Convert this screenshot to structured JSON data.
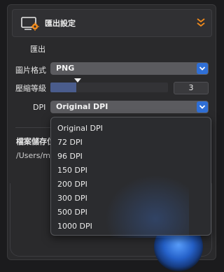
{
  "header": {
    "title": "匯出設定"
  },
  "section": {
    "label": "匯出"
  },
  "format": {
    "label": "圖片格式",
    "value": "PNG"
  },
  "compression": {
    "label": "壓縮等級",
    "value": "3",
    "level_fraction": 0.22
  },
  "dpi": {
    "label": "DPI",
    "value": "Original DPI"
  },
  "save": {
    "label": "檔案儲存位",
    "path": "/Users/m"
  },
  "dropdown": {
    "options": [
      "Original DPI",
      "72 DPI",
      "96 DPI",
      "150 DPI",
      "200 DPI",
      "300 DPI",
      "500 DPI",
      "1000 DPI"
    ]
  },
  "colors": {
    "accent": "#2f6fd6",
    "icon_orange": "#f08a1c"
  }
}
